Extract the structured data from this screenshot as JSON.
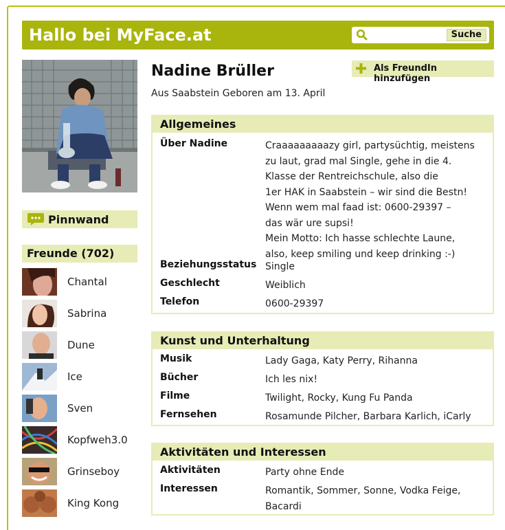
{
  "header": {
    "title": "Hallo bei MyFace.at",
    "search_button": "Suche",
    "search_value": ""
  },
  "profile": {
    "name": "Nadine Brüller",
    "subtitle": "Aus Saabstein Geboren am 13. April",
    "add_friend_label": "Als FreundIn hinzufügen"
  },
  "sidebar": {
    "pinnwand_label": "Pinnwand",
    "friends_label": "Freunde (702)",
    "friends": [
      "Chantal",
      "Sabrina",
      "Dune",
      "Ice",
      "Sven",
      "Kopfweh3.0",
      "Grinseboy",
      "King Kong"
    ]
  },
  "sections": {
    "allgemeines": {
      "title": "Allgemeines",
      "rows": [
        {
          "key": "Über Nadine",
          "lines": [
            "Craaaaaaaaazy girl, partysüchtig, meistens",
            "zu laut, grad mal Single, gehe in die 4.",
            "Klasse der Rentreichschule, also die",
            "1er HAK in Saabstein – wir sind die Bestn!",
            "Wenn wem mal faad ist: 0600-29397 –",
            "das wär ure supsi!",
            "Mein Motto: Ich hasse schlechte Laune,",
            "also, keep smiling und keep drinking :-)"
          ]
        },
        {
          "key": "Beziehungsstatus",
          "value": "Single"
        },
        {
          "key": "Geschlecht",
          "value": "Weiblich"
        },
        {
          "key": "Telefon",
          "value": "0600-29397"
        }
      ]
    },
    "kunst": {
      "title": "Kunst und Unterhaltung",
      "rows": [
        {
          "key": "Musik",
          "value": "Lady Gaga, Katy Perry, Rihanna"
        },
        {
          "key": "Bücher",
          "value": "Ich les nix!"
        },
        {
          "key": "Filme",
          "value": "Twilight, Rocky, Kung Fu Panda"
        },
        {
          "key": "Fernsehen",
          "value": "Rosamunde Pilcher, Barbara Karlich, iCarly"
        }
      ]
    },
    "aktivitaeten": {
      "title": "Aktivitäten und Interessen",
      "rows": [
        {
          "key": "Aktivitäten",
          "value": "Party ohne Ende"
        },
        {
          "key": "Interessen",
          "lines": [
            "Romantik, Sommer, Sonne, Vodka Feige,",
            "Bacardi"
          ]
        }
      ]
    }
  },
  "colors": {
    "accent": "#a9b50c",
    "light": "#e7ebb6",
    "frame": "#b8c20a"
  }
}
